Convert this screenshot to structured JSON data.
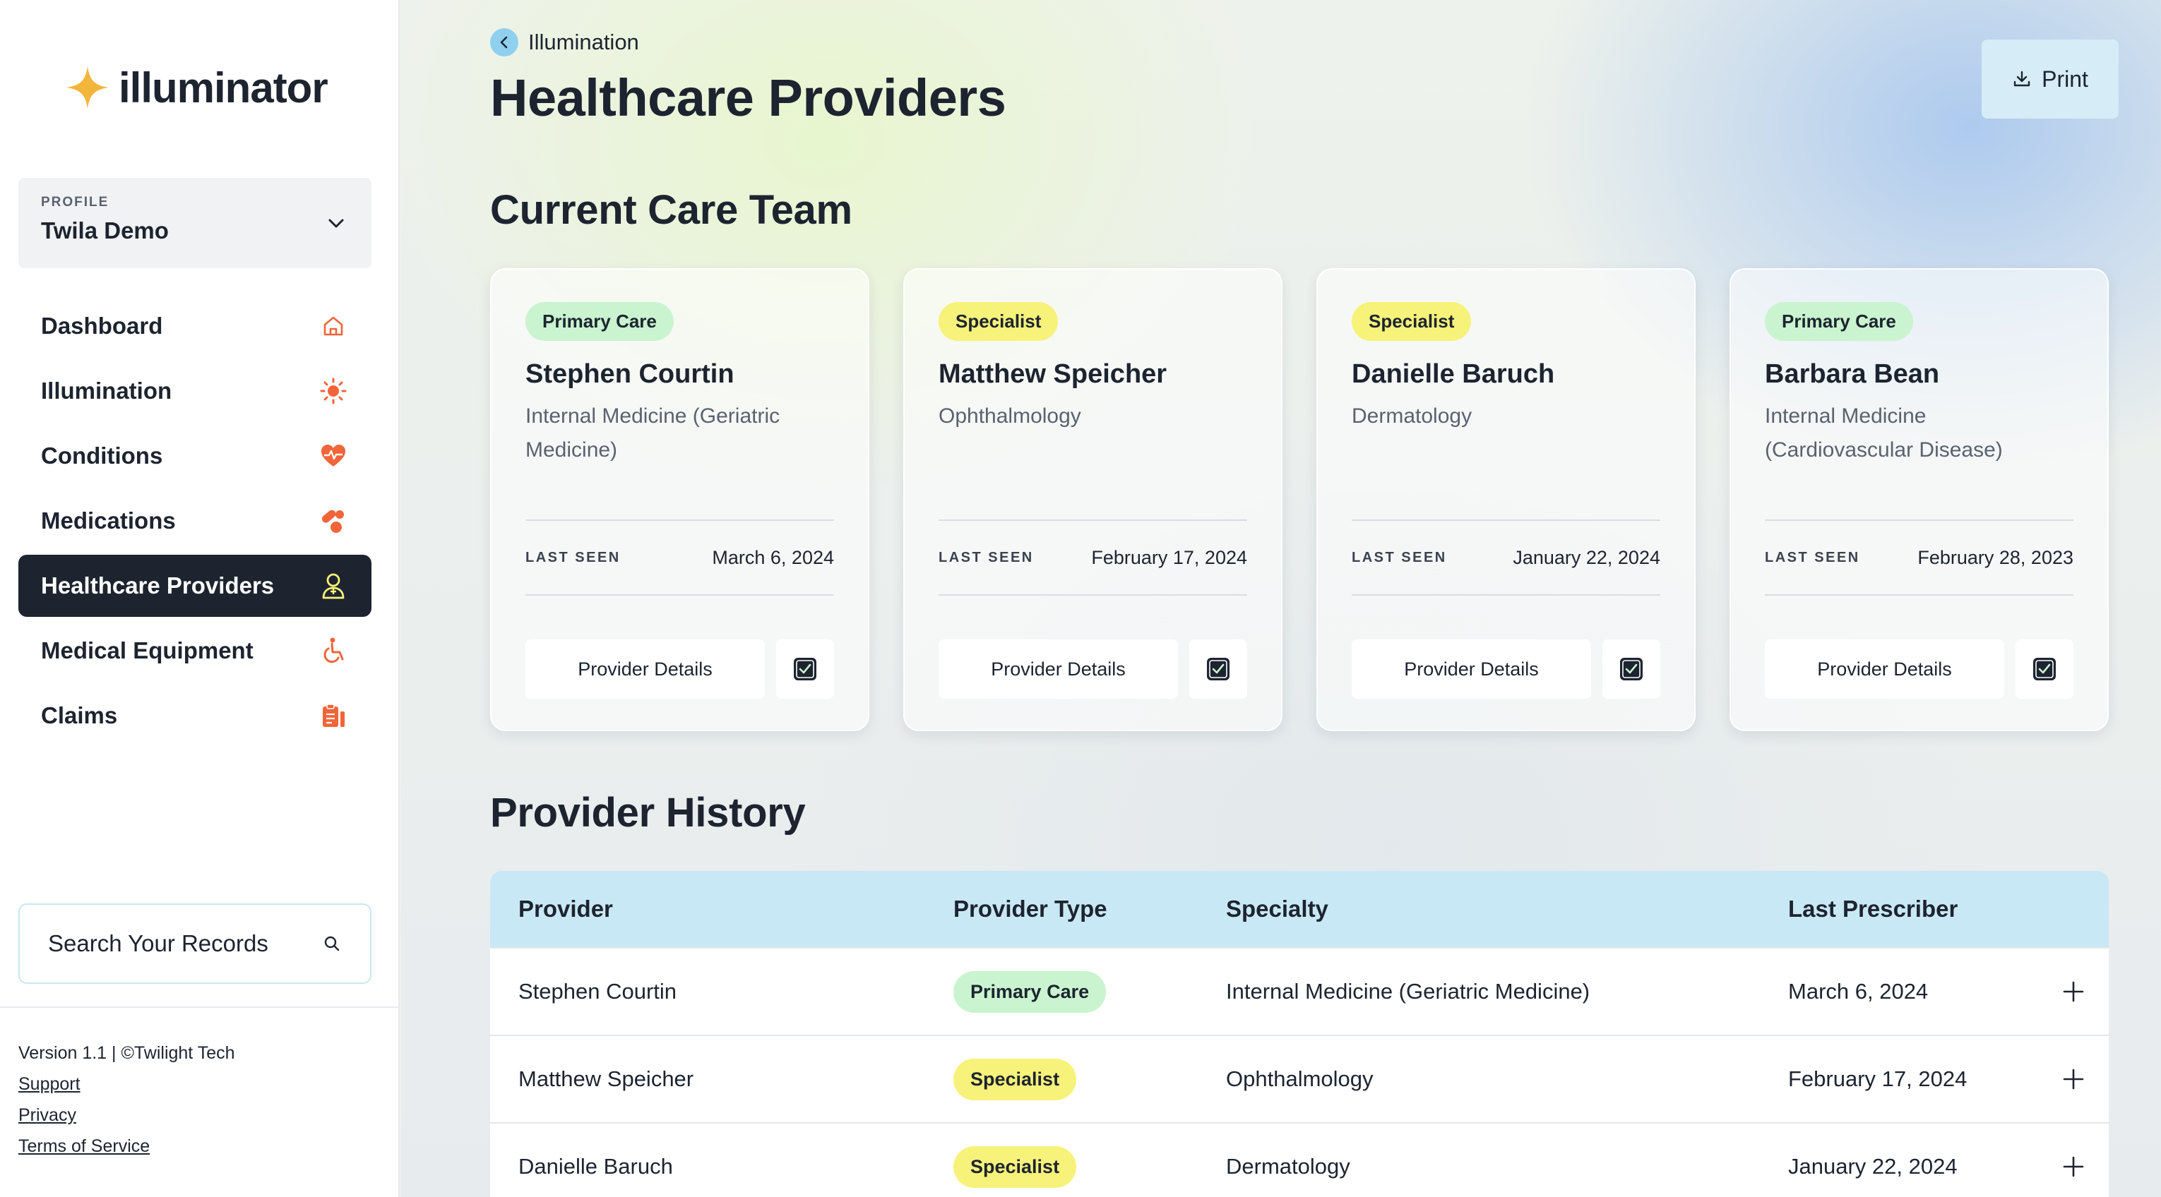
{
  "app": {
    "logo_text": "illuminator"
  },
  "profile": {
    "caption": "PROFILE",
    "name": "Twila Demo"
  },
  "nav": [
    {
      "label": "Dashboard",
      "icon": "home-icon"
    },
    {
      "label": "Illumination",
      "icon": "sun-icon"
    },
    {
      "label": "Conditions",
      "icon": "heart-pulse-icon"
    },
    {
      "label": "Medications",
      "icon": "pills-icon"
    },
    {
      "label": "Healthcare Providers",
      "icon": "doctor-icon",
      "active": true
    },
    {
      "label": "Medical Equipment",
      "icon": "wheelchair-icon"
    },
    {
      "label": "Claims",
      "icon": "clipboard-icon"
    }
  ],
  "search": {
    "label": "Search Your Records"
  },
  "footer": {
    "version": "Version 1.1 | ©Twilight Tech",
    "support": "Support",
    "privacy": "Privacy",
    "terms": "Terms of Service"
  },
  "header": {
    "breadcrumb": "Illumination",
    "title": "Healthcare Providers",
    "print_label": "Print"
  },
  "care_team": {
    "title": "Current Care Team",
    "last_seen_label": "LAST SEEN",
    "details_label": "Provider Details",
    "cards": [
      {
        "type": "Primary Care",
        "name": "Stephen Courtin",
        "specialty": "Internal Medicine (Geriatric Medicine)",
        "last_seen": "March 6, 2024"
      },
      {
        "type": "Specialist",
        "name": "Matthew Speicher",
        "specialty": "Ophthalmology",
        "last_seen": "February 17, 2024"
      },
      {
        "type": "Specialist",
        "name": "Danielle Baruch",
        "specialty": "Dermatology",
        "last_seen": "January 22, 2024"
      },
      {
        "type": "Primary Care",
        "name": "Barbara Bean",
        "specialty": "Internal Medicine (Cardiovascular Disease)",
        "last_seen": "February 28, 2023"
      }
    ]
  },
  "history": {
    "title": "Provider History",
    "columns": [
      "Provider",
      "Provider Type",
      "Specialty",
      "Last Prescriber"
    ],
    "rows": [
      {
        "provider": "Stephen Courtin",
        "type": "Primary Care",
        "specialty": "Internal Medicine (Geriatric Medicine)",
        "last_prescriber": "March 6, 2024"
      },
      {
        "provider": "Matthew Speicher",
        "type": "Specialist",
        "specialty": "Ophthalmology",
        "last_prescriber": "February 17, 2024"
      },
      {
        "provider": "Danielle Baruch",
        "type": "Specialist",
        "specialty": "Dermatology",
        "last_prescriber": "January 22, 2024"
      }
    ]
  },
  "colors": {
    "accent_orange": "#f0653a",
    "primary_pill": "#c9f4cf",
    "specialist_pill": "#f7f27a",
    "dark_nav": "#1d2430",
    "table_header": "#c9e8f5"
  }
}
